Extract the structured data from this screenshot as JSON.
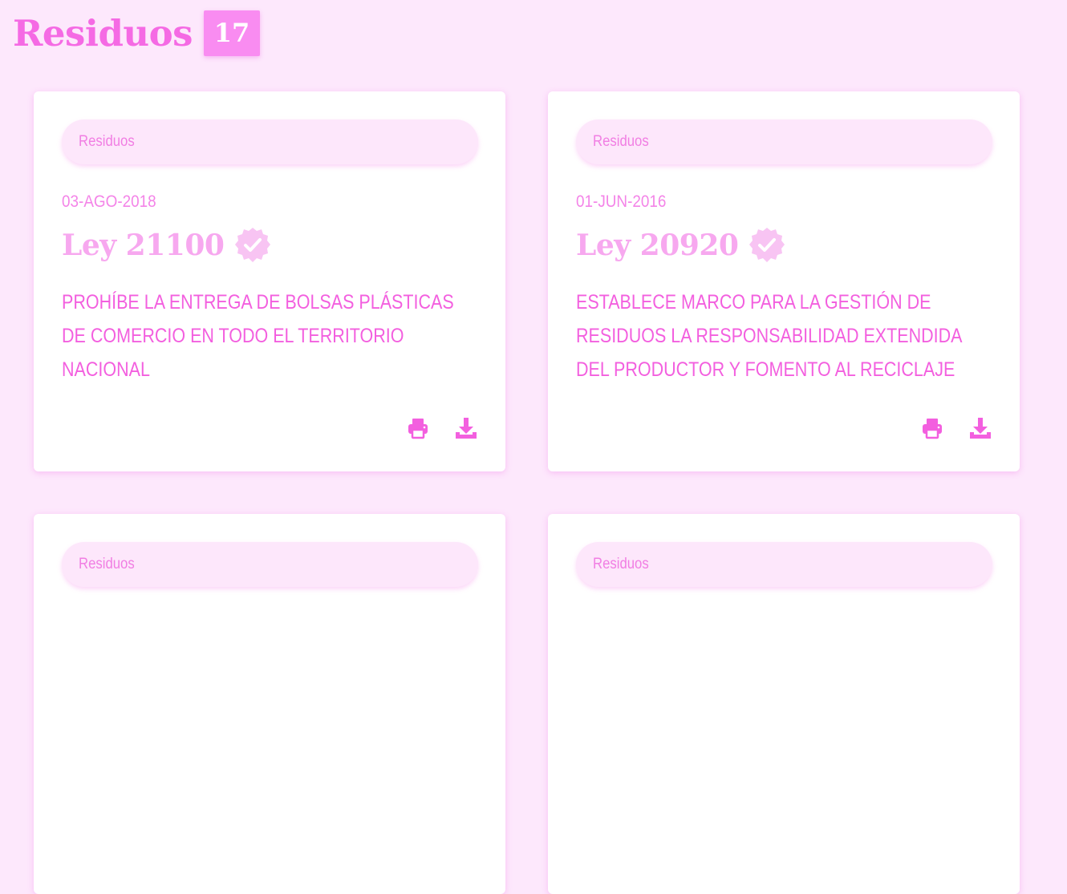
{
  "header": {
    "title": "Residuos",
    "count": "17"
  },
  "cards": [
    {
      "category": "Residuos",
      "date": "03-AGO-2018",
      "law": "Ley 21100",
      "description": "PROHÍBE LA ENTREGA DE BOLSAS PLÁSTICAS DE COMERCIO EN TODO EL TERRITORIO NACIONAL"
    },
    {
      "category": "Residuos",
      "date": "01-JUN-2016",
      "law": "Ley 20920",
      "description": "ESTABLECE MARCO PARA LA GESTIÓN DE RESIDUOS LA RESPONSABILIDAD EXTENDIDA DEL PRODUCTOR Y FOMENTO AL RECICLAJE"
    },
    {
      "category": "Residuos"
    },
    {
      "category": "Residuos"
    }
  ],
  "icons": {
    "verified": "verified-badge-icon",
    "print": "printer-icon",
    "download": "download-icon"
  },
  "colors": {
    "background": "#fde8fc",
    "accent": "#f56ae4",
    "badge": "#f98cf1",
    "text": "#f35fdf"
  }
}
